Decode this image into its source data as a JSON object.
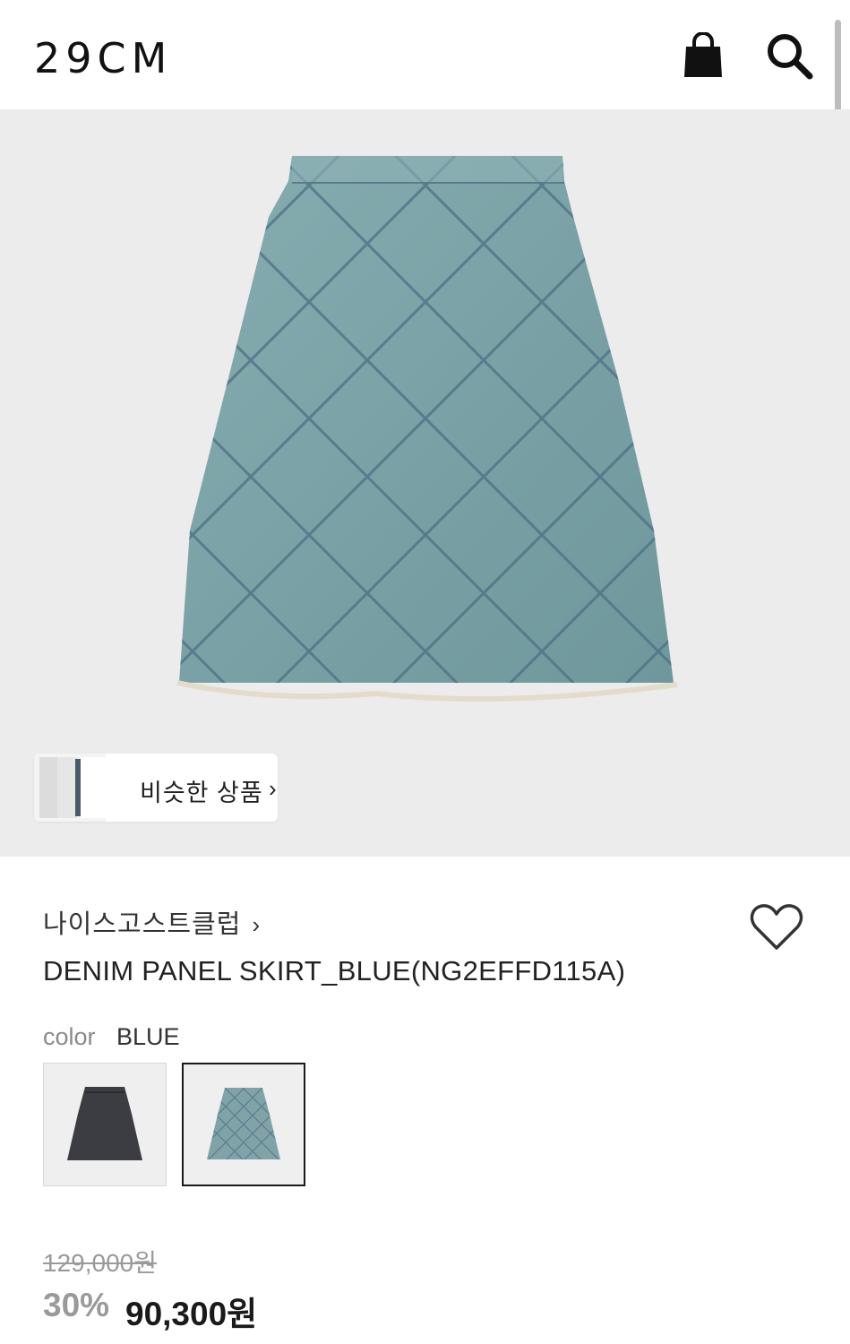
{
  "header": {
    "logo": "29CM",
    "icons": [
      "shopping-bag-icon",
      "search-icon"
    ]
  },
  "hero": {
    "similar_products_label": "비슷한 상품",
    "similar_products_chevron": "›"
  },
  "product": {
    "brand": "나이스고스트클럽",
    "brand_chevron": "›",
    "title": "DENIM PANEL SKIRT_BLUE(NG2EFFD115A)",
    "color_label": "color",
    "color_value": "BLUE",
    "swatches": [
      {
        "color": "#3b3d42",
        "selected": false
      },
      {
        "color": "#7fa3a6",
        "selected": true
      }
    ],
    "original_price": "129,000원",
    "discount": "30%",
    "sale_price": "90,300원"
  },
  "colors": {
    "hero_bg": "#ececec",
    "denim": "#7fa5a9",
    "denim_dark": "#3b3d42"
  }
}
